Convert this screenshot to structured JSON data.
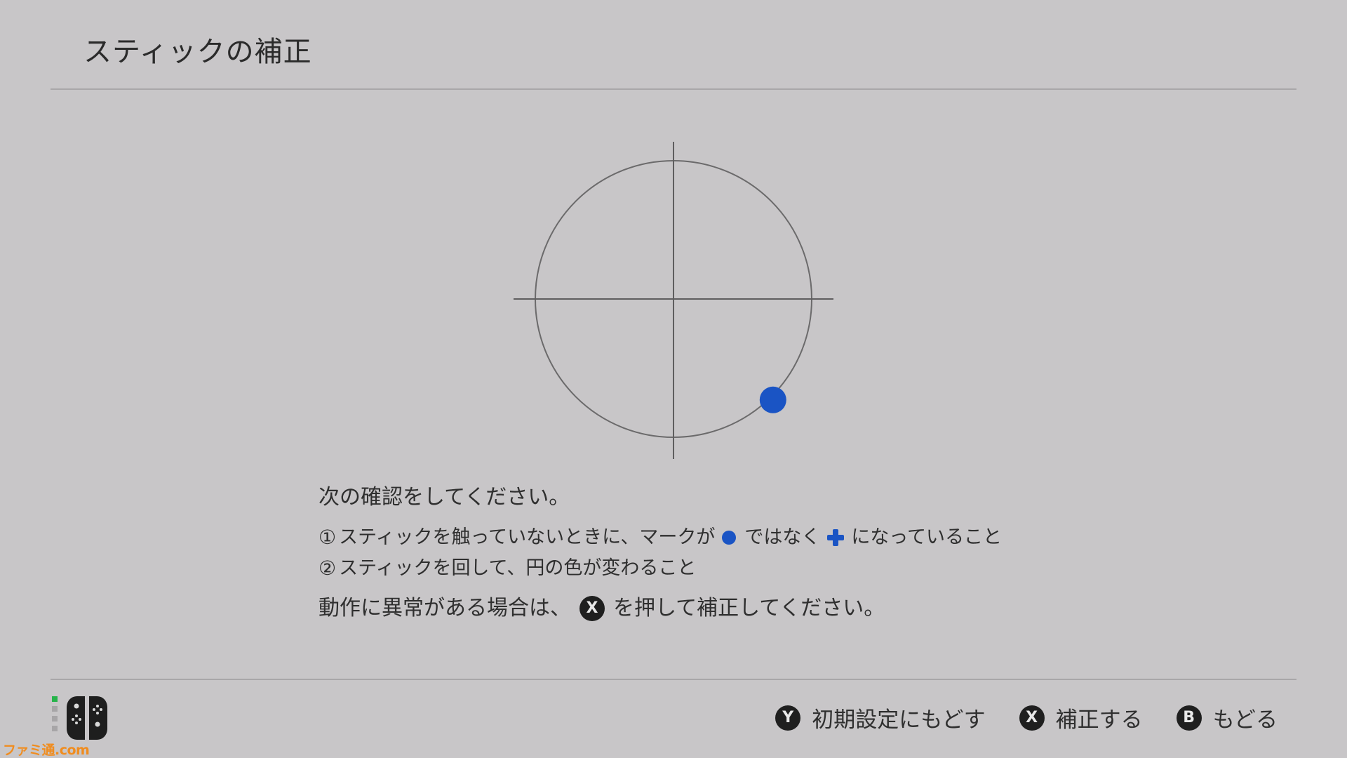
{
  "header": {
    "title": "スティックの補正"
  },
  "calibration": {
    "marker_color": "#1a54c4",
    "stick_position": {
      "x": 0.72,
      "y": -0.73
    }
  },
  "instructions": {
    "heading": "次の確認をしてください。",
    "step1": {
      "number": "①",
      "text_before": "スティックを触っていないときに、マークが",
      "text_middle": "ではなく",
      "text_after": "になっていること"
    },
    "step2": {
      "number": "②",
      "text": "スティックを回して、円の色が変わること"
    },
    "note": {
      "text_before": "動作に異常がある場合は、",
      "button": "X",
      "text_after": "を押して補正してください。"
    }
  },
  "footer": {
    "controller_icon": "joycon-pair-icon",
    "actions": [
      {
        "button": "Y",
        "label": "初期設定にもどす"
      },
      {
        "button": "X",
        "label": "補正する"
      },
      {
        "button": "B",
        "label": "もどる"
      }
    ]
  },
  "watermark": "ファミ通.com"
}
